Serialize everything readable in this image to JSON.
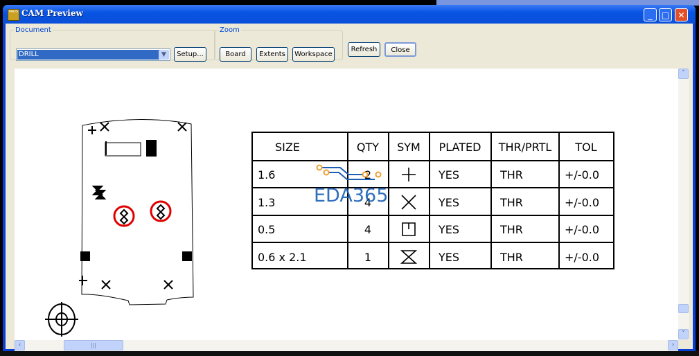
{
  "window": {
    "title": "CAM Preview",
    "app_icon_text": "PADS"
  },
  "document": {
    "group_label": "Document",
    "selected": "DRILL",
    "setup_label": "Setup..."
  },
  "zoom": {
    "group_label": "Zoom",
    "board_label": "Board",
    "extents_label": "Extents",
    "workspace_label": "Workspace"
  },
  "actions": {
    "refresh_label": "Refresh",
    "close_label": "Close"
  },
  "drill_table": {
    "headers": [
      "SIZE",
      "QTY",
      "SYM",
      "PLATED",
      "THR/PRTL",
      "TOL"
    ],
    "rows": [
      {
        "size": "1.6",
        "qty": "2",
        "sym": "plus",
        "plated": "YES",
        "thr": "THR",
        "tol": "+/-0.0"
      },
      {
        "size": "1.3",
        "qty": "4",
        "sym": "x",
        "plated": "YES",
        "thr": "THR",
        "tol": "+/-0.0"
      },
      {
        "size": "0.5",
        "qty": "4",
        "sym": "box-tick",
        "plated": "YES",
        "thr": "THR",
        "tol": "+/-0.0"
      },
      {
        "size": "0.6  x  2.1",
        "qty": "1",
        "sym": "hourglass",
        "plated": "YES",
        "thr": "THR",
        "tol": "+/-0.0"
      }
    ]
  },
  "watermark": {
    "text": "EDA365",
    "color": "#1a5fb4",
    "accent": "#f0a030"
  },
  "colors": {
    "titlebar": "#0854e3",
    "highlight": "#e00000"
  }
}
